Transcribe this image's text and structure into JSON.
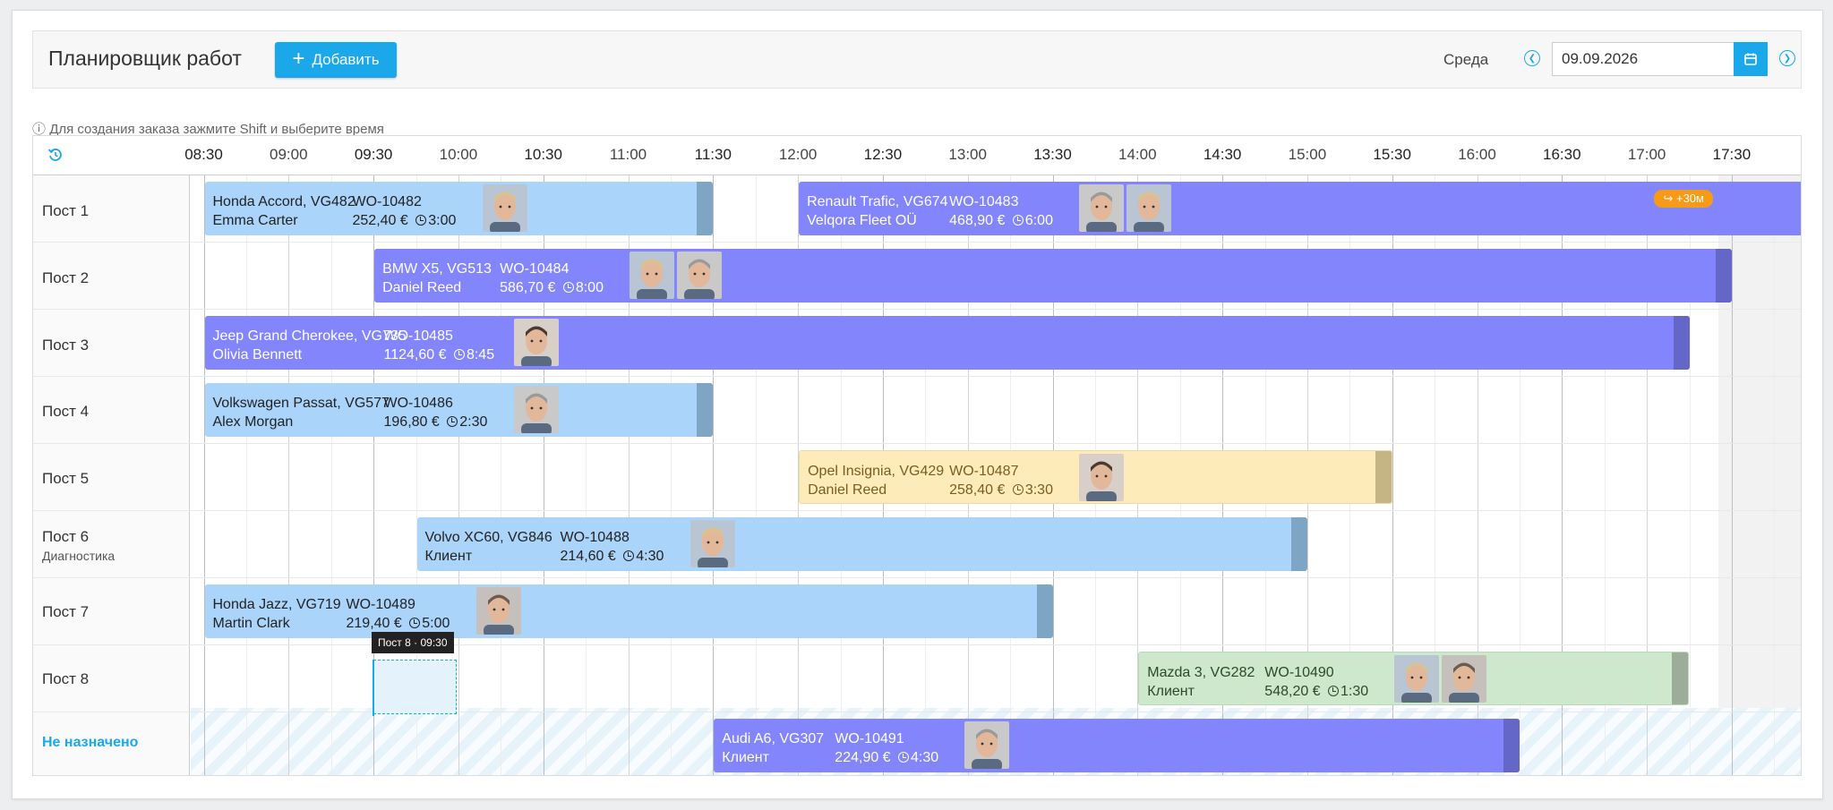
{
  "header": {
    "title": "Планировщик работ",
    "add_label": "Добавить",
    "day_name": "Среда",
    "date_value": "09.09.2026"
  },
  "hint": "Для создания заказа зажмите Shift и выберите время",
  "times": [
    "08:30",
    "09:00",
    "09:30",
    "10:00",
    "10:30",
    "11:00",
    "11:30",
    "12:00",
    "12:30",
    "13:00",
    "13:30",
    "14:00",
    "14:30",
    "15:00",
    "15:30",
    "16:00",
    "16:30",
    "17:00",
    "17:30"
  ],
  "rows": [
    {
      "label": "Пост 1",
      "sub": ""
    },
    {
      "label": "Пост 2",
      "sub": ""
    },
    {
      "label": "Пост 3",
      "sub": ""
    },
    {
      "label": "Пост 4",
      "sub": ""
    },
    {
      "label": "Пост 5",
      "sub": ""
    },
    {
      "label": "Пост 6",
      "sub": "Диагностика"
    },
    {
      "label": "Пост 7",
      "sub": ""
    },
    {
      "label": "Пост 8",
      "sub": ""
    }
  ],
  "unassigned_label": "Не назначено",
  "jobs": [
    {
      "car": "Honda Accord, VG482",
      "client": "Emma Carter",
      "wo": "WO-10482",
      "price": "252,40 €",
      "dur": "3:00",
      "color": "#abd4fb"
    },
    {
      "car": "Renault Trafic, VG674",
      "client": "Velqora Fleet OÜ",
      "wo": "WO-10483",
      "price": "468,90 €",
      "dur": "6:00",
      "color": "#8285fb",
      "badge": "+30м"
    },
    {
      "car": "BMW X5, VG513",
      "client": "Daniel Reed",
      "wo": "WO-10484",
      "price": "586,70 €",
      "dur": "8:00",
      "color": "#8285fb"
    },
    {
      "car": "Jeep Grand Cherokee, VG735",
      "client": "Olivia Bennett",
      "wo": "WO-10485",
      "price": "1124,60 €",
      "dur": "8:45",
      "color": "#8285fb"
    },
    {
      "car": "Volkswagen Passat, VG577",
      "client": "Alex Morgan",
      "wo": "WO-10486",
      "price": "196,80 €",
      "dur": "2:30",
      "color": "#abd4fb"
    },
    {
      "car": "Opel Insignia, VG429",
      "client": "Daniel Reed",
      "wo": "WO-10487",
      "price": "258,40 €",
      "dur": "3:30",
      "color": "#fdecb9"
    },
    {
      "car": "Volvo XC60, VG846",
      "client": "Клиент",
      "wo": "WO-10488",
      "price": "214,60 €",
      "dur": "4:30",
      "color": "#abd4fb"
    },
    {
      "car": "Honda Jazz, VG719",
      "client": "Martin Clark",
      "wo": "WO-10489",
      "price": "219,40 €",
      "dur": "5:00",
      "color": "#abd4fb"
    },
    {
      "car": "Mazda 3, VG282",
      "client": "Клиент",
      "wo": "WO-10490",
      "price": "548,20 €",
      "dur": "1:30",
      "color": "#cde8cc"
    },
    {
      "car": "Audi A6, VG307",
      "client": "Клиент",
      "wo": "WO-10491",
      "price": "224,90 €",
      "dur": "4:30",
      "color": "#8285fb"
    }
  ],
  "tooltip": "Пост 8 · 09:30",
  "icons": {
    "add": "plus-icon",
    "prev": "chevron-left-icon",
    "next": "chevron-right-icon",
    "calendar": "calendar-icon",
    "info": "info-icon",
    "refresh": "history-icon",
    "clock": "clock-icon",
    "extend": "arrow-forward-icon"
  }
}
